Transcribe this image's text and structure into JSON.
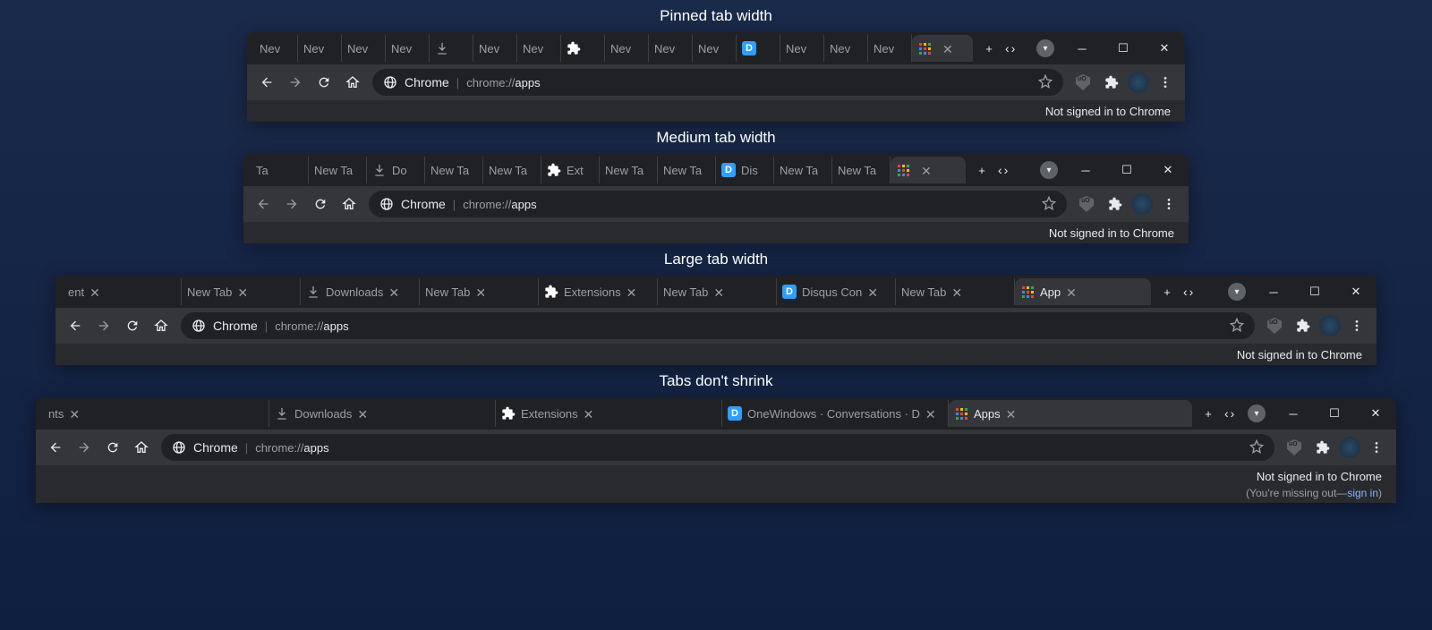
{
  "captions": {
    "pinned": "Pinned tab width",
    "medium": "Medium tab width",
    "large": "Large tab width",
    "noshrink": "Tabs don't shrink"
  },
  "omnibox": {
    "site": "Chrome",
    "prefix": "chrome://",
    "page": "apps"
  },
  "status": {
    "not_signed": "Not signed in to Chrome",
    "missing_prefix": "(You're missing out—",
    "sign_in": "sign in",
    "missing_suffix": ")"
  },
  "tabs": {
    "pinned": [
      {
        "label": "Nev",
        "icon": ""
      },
      {
        "label": "Nev",
        "icon": ""
      },
      {
        "label": "Nev",
        "icon": ""
      },
      {
        "label": "Nev",
        "icon": ""
      },
      {
        "label": "",
        "icon": "download"
      },
      {
        "label": "Nev",
        "icon": ""
      },
      {
        "label": "Nev",
        "icon": ""
      },
      {
        "label": "",
        "icon": "puzzle"
      },
      {
        "label": "Nev",
        "icon": ""
      },
      {
        "label": "Nev",
        "icon": ""
      },
      {
        "label": "Nev",
        "icon": ""
      },
      {
        "label": "",
        "icon": "disqus"
      },
      {
        "label": "Nev",
        "icon": ""
      },
      {
        "label": "Nev",
        "icon": ""
      },
      {
        "label": "Nev",
        "icon": ""
      }
    ],
    "pinned_active": {
      "label": "",
      "icon": "apps"
    },
    "medium": [
      {
        "label": "Ta",
        "icon": ""
      },
      {
        "label": "New Ta",
        "icon": ""
      },
      {
        "label": "Do",
        "icon": "download"
      },
      {
        "label": "New Ta",
        "icon": ""
      },
      {
        "label": "New Ta",
        "icon": ""
      },
      {
        "label": "Ext",
        "icon": "puzzle"
      },
      {
        "label": "New Ta",
        "icon": ""
      },
      {
        "label": "New Ta",
        "icon": ""
      },
      {
        "label": "Dis",
        "icon": "disqus"
      },
      {
        "label": "New Ta",
        "icon": ""
      },
      {
        "label": "New Ta",
        "icon": ""
      }
    ],
    "medium_active": {
      "label": "",
      "icon": "apps"
    },
    "large": [
      {
        "label": "ent",
        "icon": "",
        "close": true
      },
      {
        "label": "New Tab",
        "icon": "",
        "close": true
      },
      {
        "label": "Downloads",
        "icon": "download",
        "close": true
      },
      {
        "label": "New Tab",
        "icon": "",
        "close": true
      },
      {
        "label": "Extensions",
        "icon": "puzzle",
        "close": true
      },
      {
        "label": "New Tab",
        "icon": "",
        "close": true
      },
      {
        "label": "Disqus Con",
        "icon": "disqus",
        "close": true
      },
      {
        "label": "New Tab",
        "icon": "",
        "close": true
      }
    ],
    "large_active": {
      "label": "App",
      "icon": "apps"
    },
    "noshrink": [
      {
        "label": "nts",
        "icon": "",
        "close": true
      },
      {
        "label": "Downloads",
        "icon": "download",
        "close": true
      },
      {
        "label": "Extensions",
        "icon": "puzzle",
        "close": true
      },
      {
        "label": "OneWindows · Conversations · D",
        "icon": "disqus",
        "close": true
      }
    ],
    "noshrink_active": {
      "label": "Apps",
      "icon": "apps"
    }
  }
}
